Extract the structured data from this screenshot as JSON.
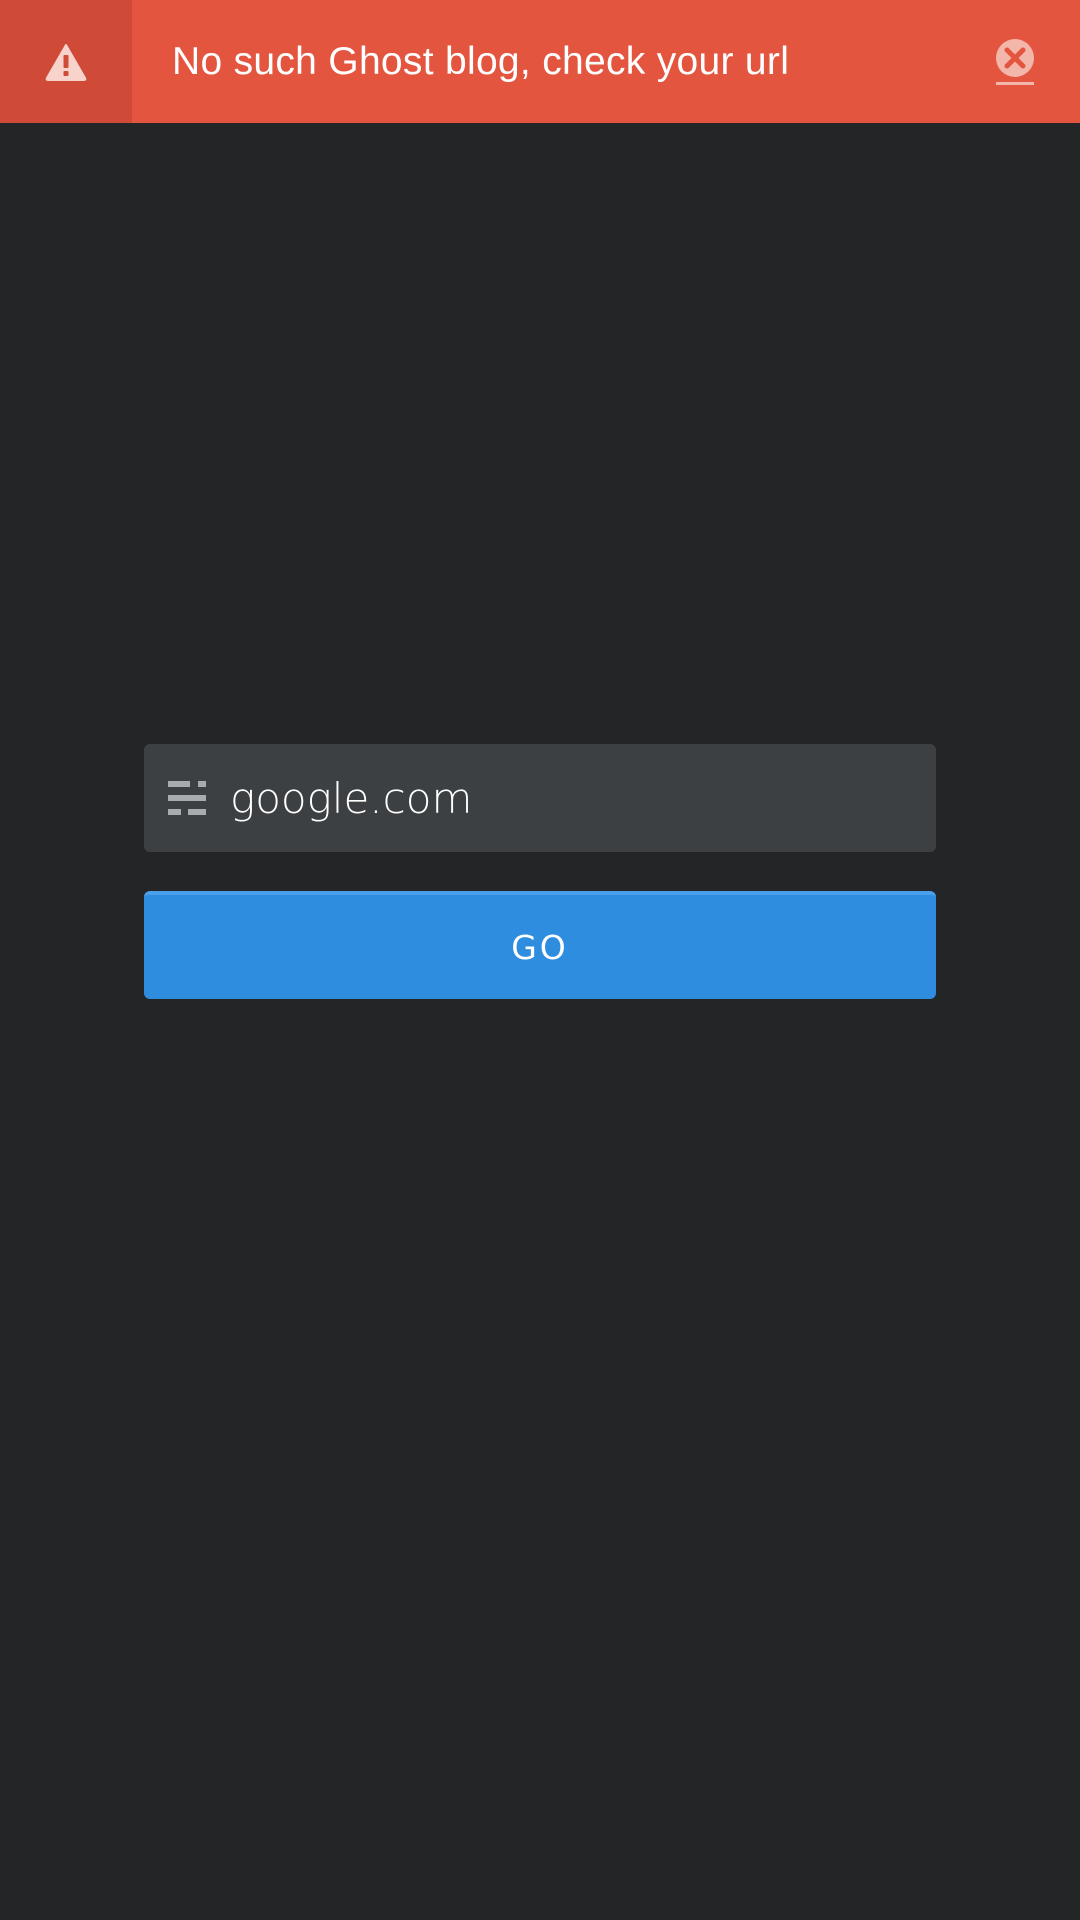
{
  "notification": {
    "message": "No such Ghost blog, check your url",
    "icon": "warning-icon",
    "close_icon": "close-icon",
    "color": "#e45540",
    "icon_box_color": "#cf4b38"
  },
  "form": {
    "url_input": {
      "value": "google.com",
      "icon": "url-icon"
    },
    "go_button_label": "GO",
    "button_color": "#2f8de0"
  },
  "background_color": "#242527"
}
